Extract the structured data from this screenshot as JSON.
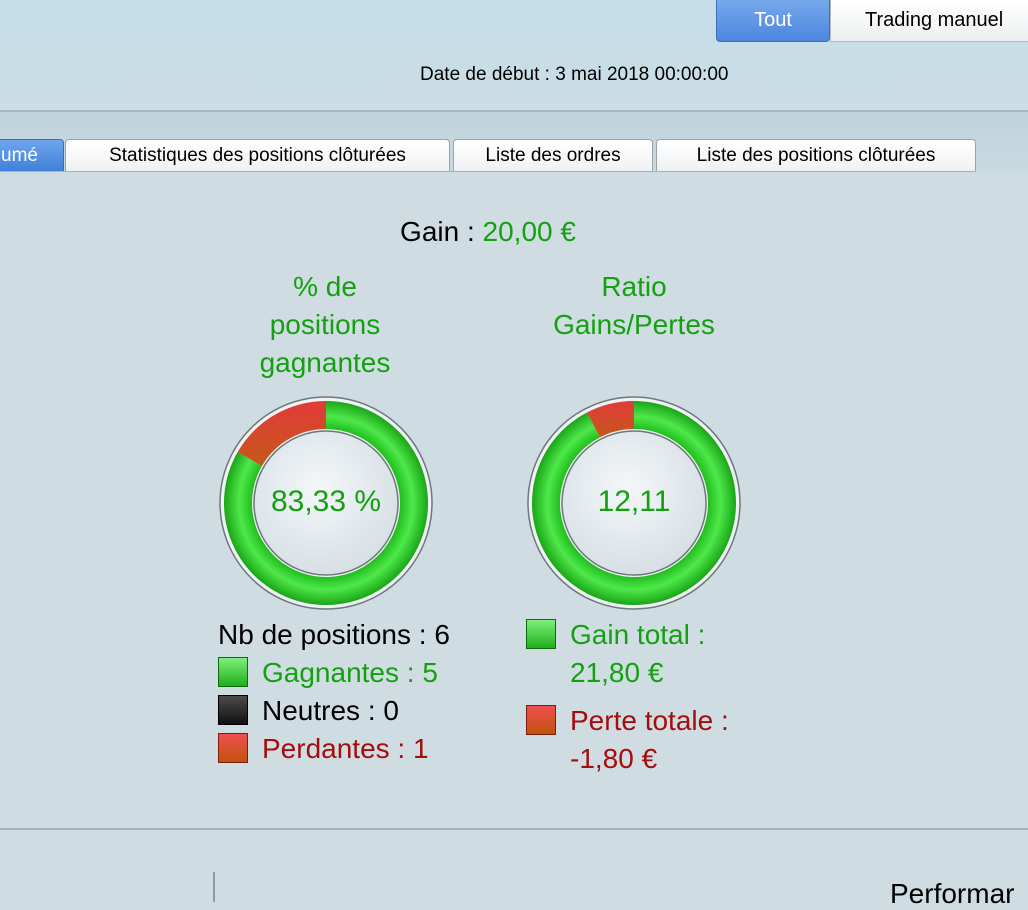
{
  "mode_buttons": {
    "all": "Tout",
    "manual": "Trading manuel"
  },
  "date": {
    "label": "Date de début :",
    "value": "3 mai 2018 00:00:00"
  },
  "tabs": [
    {
      "label": "umé"
    },
    {
      "label": "Statistiques des positions clôturées"
    },
    {
      "label": "Liste des ordres"
    },
    {
      "label": "Liste des positions clôturées"
    }
  ],
  "gain": {
    "label": "Gain :",
    "value": "20,00 €"
  },
  "winning_chart": {
    "title_lines": [
      "% de",
      "positions",
      "gagnantes"
    ],
    "center": "83,33 %",
    "fraction_green": 0.8333
  },
  "ratio_chart": {
    "title_lines": [
      "Ratio",
      "Gains/Pertes"
    ],
    "center": "12,11",
    "fraction_green": 0.9237
  },
  "positions": {
    "count_label": "Nb de positions : 6",
    "winning": "Gagnantes : 5",
    "neutral": "Neutres : 0",
    "losing": "Perdantes : 1"
  },
  "totals": {
    "gain_label": "Gain total :",
    "gain_value": "21,80 €",
    "loss_label": "Perte totale :",
    "loss_value": "-1,80 €"
  },
  "bottom": {
    "perf_label": "Performar"
  },
  "colors": {
    "green": "#14a011",
    "red": "#a30d0d",
    "accent": "#4c86de"
  }
}
